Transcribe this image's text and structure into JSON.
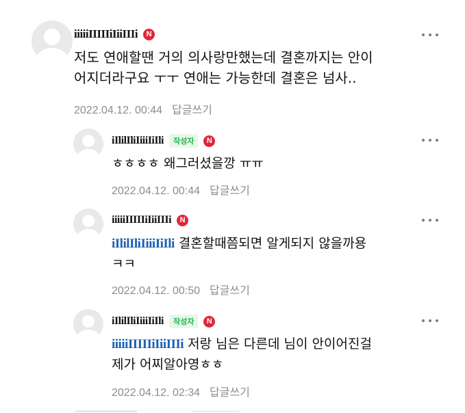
{
  "comments": [
    {
      "nickname": "iiiiiIIIIIiIiiIIIi",
      "author_badge": "",
      "text_lines": [
        "저도 연애할땐 거의 의사랑만했는데 결혼까지는 안이",
        "어지더라구요 ㅜㅜ 연애는 가능한데 결혼은 넘사.."
      ],
      "mention": "",
      "date": "2022.04.12. 00:44",
      "reply_label": "답글쓰기"
    },
    {
      "nickname": "iIlilIliIiiiIiIli",
      "author_badge": "작성자",
      "text_lines": [
        "ㅎㅎㅎㅎ 왜그러셨을깡 ㅠㅠ"
      ],
      "mention": "",
      "date": "2022.04.12. 00:44",
      "reply_label": "답글쓰기"
    },
    {
      "nickname": "iiiiiIIIIIiIiiIIIi",
      "author_badge": "",
      "text_lines": [
        "결혼할때쯤되면 알게되지 않을까용",
        "ㅋㅋ"
      ],
      "mention": "iIlilIliIiiiIiIli",
      "date": "2022.04.12. 00:50",
      "reply_label": "답글쓰기"
    },
    {
      "nickname": "iIlilIliIiiiIiIli",
      "author_badge": "작성자",
      "text_lines": [
        "저랑 님은 다른데 님이 안이어진걸",
        "제가 어찌알아영ㅎㅎ"
      ],
      "mention": "iiiiiIIIIIiIiiIIIi",
      "date": "2022.04.12. 02:34",
      "reply_label": "답글쓰기"
    }
  ],
  "icons": {
    "naver_badge": "N",
    "more": "more-dots-icon"
  },
  "colors": {
    "naver_red": "#e0283a",
    "author_green": "#1eb34a",
    "mention_blue": "#1a5fb4",
    "meta_gray": "#8c8c8c"
  }
}
